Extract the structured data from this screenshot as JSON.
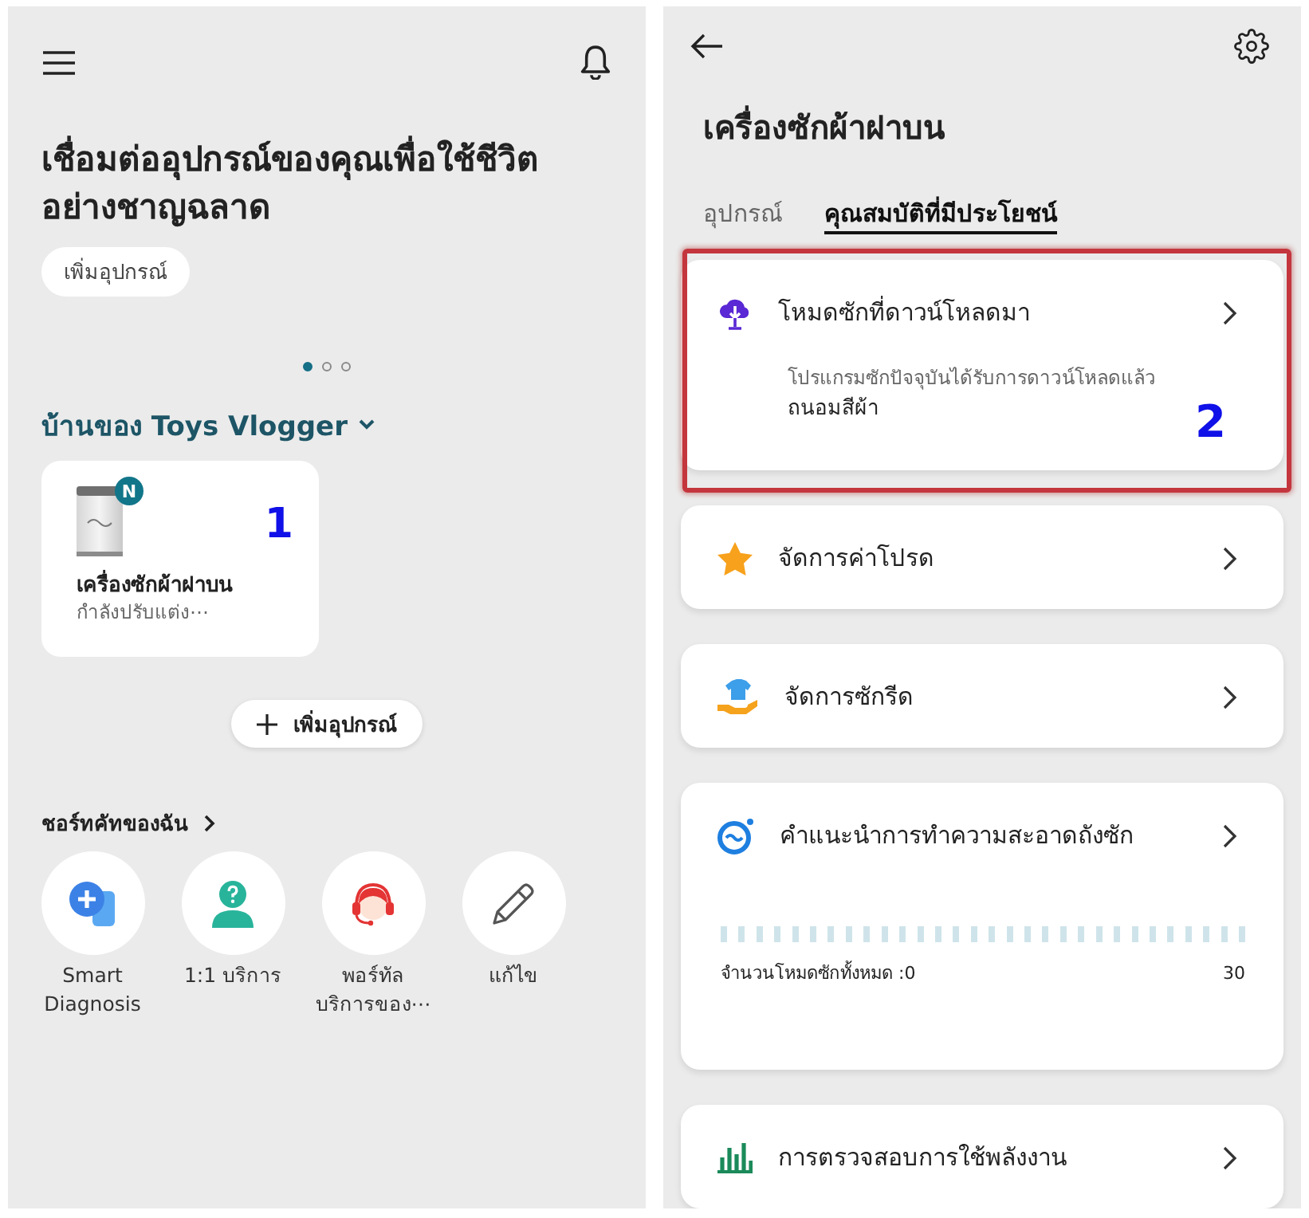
{
  "left_screen": {
    "headline": "เชื่อมต่ออุปกรณ์ของคุณเพื่อใช้ชีวิต\nอย่างชาญฉลาด",
    "add_device_pill": "เพิ่มอุปกรณ์",
    "pager": [
      {
        "selected": true
      },
      {
        "selected": false
      },
      {
        "selected": false
      }
    ],
    "home_name": "บ้านของ Toys Vlogger",
    "devices": [
      {
        "name": "เครื่องซักผ้าฝาบน",
        "status": "กำลังปรับแต่ง⋯",
        "badge": "N",
        "annotation": "1"
      }
    ],
    "add_device_button": "เพิ่มอุปกรณ์",
    "shortcuts_title": "ชอร์ทคัทของฉัน",
    "shortcuts": [
      {
        "label": "Smart Diagnosis"
      },
      {
        "label": "1:1 บริการ"
      },
      {
        "label": "พอร์ทัล บริการของ⋯"
      },
      {
        "label": "แก้ไข"
      }
    ]
  },
  "right_screen": {
    "title": "เครื่องซักผ้าฝาบน",
    "tabs": [
      {
        "label": "อุปกรณ์",
        "selected": false
      },
      {
        "label": "คุณสมบัติที่มีประโยชน์",
        "selected": true
      }
    ],
    "features": [
      {
        "kind": "detail",
        "title": "โหมดซักที่ดาวน์โหลดมา",
        "description": "โปรแกรมซักปัจจุบันได้รับการดาวน์โหลดแล้ว",
        "value": "ถนอมสีผ้า",
        "highlighted": true,
        "annotation": "2"
      },
      {
        "kind": "link",
        "title": "จัดการค่าโปรด",
        "highlighted": false
      },
      {
        "kind": "link",
        "title": "จัดการซักรีด",
        "highlighted": false
      },
      {
        "kind": "meter",
        "title": "คำแนะนำการทำความสะอาดถังซัก",
        "count_label": "จำนวนโหมดซักทั้งหมด :0",
        "max_label": "30",
        "highlighted": false
      },
      {
        "kind": "link",
        "title": "การตรวจสอบการใช้พลังงาน",
        "highlighted": false
      }
    ]
  }
}
